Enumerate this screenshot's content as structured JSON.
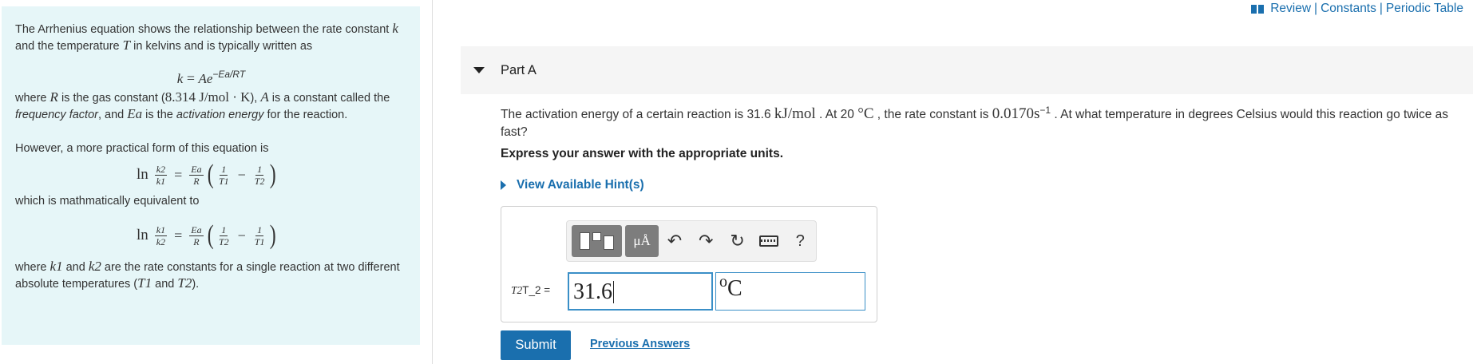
{
  "header_links": {
    "review": "Review",
    "constants": "Constants",
    "periodic_table": "Periodic Table",
    "separator": "|"
  },
  "info": {
    "intro_1": "The Arrhenius equation shows the relationship between the rate constant ",
    "intro_k": "k",
    "intro_2": " and the temperature ",
    "intro_T": "T",
    "intro_3": " in kelvins and is typically written as",
    "arrhenius_lhs": "k",
    "arrhenius_eq": " = ",
    "arrhenius_A": "Ae",
    "arrhenius_exp": "−Ea/RT",
    "gas_1": "where ",
    "gas_R": "R",
    "gas_2": " is the gas constant (",
    "gas_value": "8.314 J/mol · K",
    "gas_3": "), ",
    "gas_A": "A",
    "gas_4": " is a constant called the ",
    "gas_freq": "frequency factor",
    "gas_5": ", and ",
    "gas_Ea": "Ea",
    "gas_6": " is the ",
    "gas_act": "activation energy",
    "gas_7": " for the reaction.",
    "practical": "However, a more practical form of this equation is",
    "equivalent": "which is mathmatically equivalent to",
    "where_1": "where ",
    "where_k1": "k1",
    "where_2": " and ",
    "where_k2": "k2",
    "where_3": " are the rate constants for a single reaction at two different absolute temperatures (",
    "where_T1": "T1",
    "where_4": " and ",
    "where_T2": "T2",
    "where_5": ")."
  },
  "eq1": {
    "ln": "ln",
    "num_l": "k2",
    "den_l": "k1",
    "num_r": "Ea",
    "den_r": "R",
    "n1": "1",
    "d1": "T1",
    "minus": "−",
    "n2": "1",
    "d2": "T2",
    "equals": "="
  },
  "eq2": {
    "ln": "ln",
    "num_l": "k1",
    "den_l": "k2",
    "num_r": "Ea",
    "den_r": "R",
    "n1": "1",
    "d1": "T2",
    "minus": "−",
    "n2": "1",
    "d2": "T1",
    "equals": "="
  },
  "part": {
    "title": "Part A"
  },
  "question": {
    "q1": "The activation energy of a certain reaction is 31.6 ",
    "unit_energy": "kJ/mol",
    "q2": " . At 20 ",
    "unit_temp": "°C",
    "q3": " , the rate constant is ",
    "rate": "0.0170s",
    "rate_exp": "−1",
    "q4": " . At what temperature in degrees Celsius would this reaction go twice as fast?"
  },
  "instructions": "Express your answer with the appropriate units.",
  "hints_label": "View Available Hint(s)",
  "toolbar": {
    "units_label": "μÅ",
    "undo": "↶",
    "redo": "↷",
    "reset": "↻",
    "help": "?"
  },
  "answer": {
    "label_var": "T2",
    "label_text": "T_2 =",
    "value": "31.6",
    "unit_deg": "o",
    "unit_letter": "C"
  },
  "buttons": {
    "submit": "Submit",
    "previous_answers": "Previous Answers"
  },
  "colors": {
    "accent": "#1a6fae",
    "panel_bg": "#e6f6f8",
    "input_border": "#3a8fc7"
  }
}
